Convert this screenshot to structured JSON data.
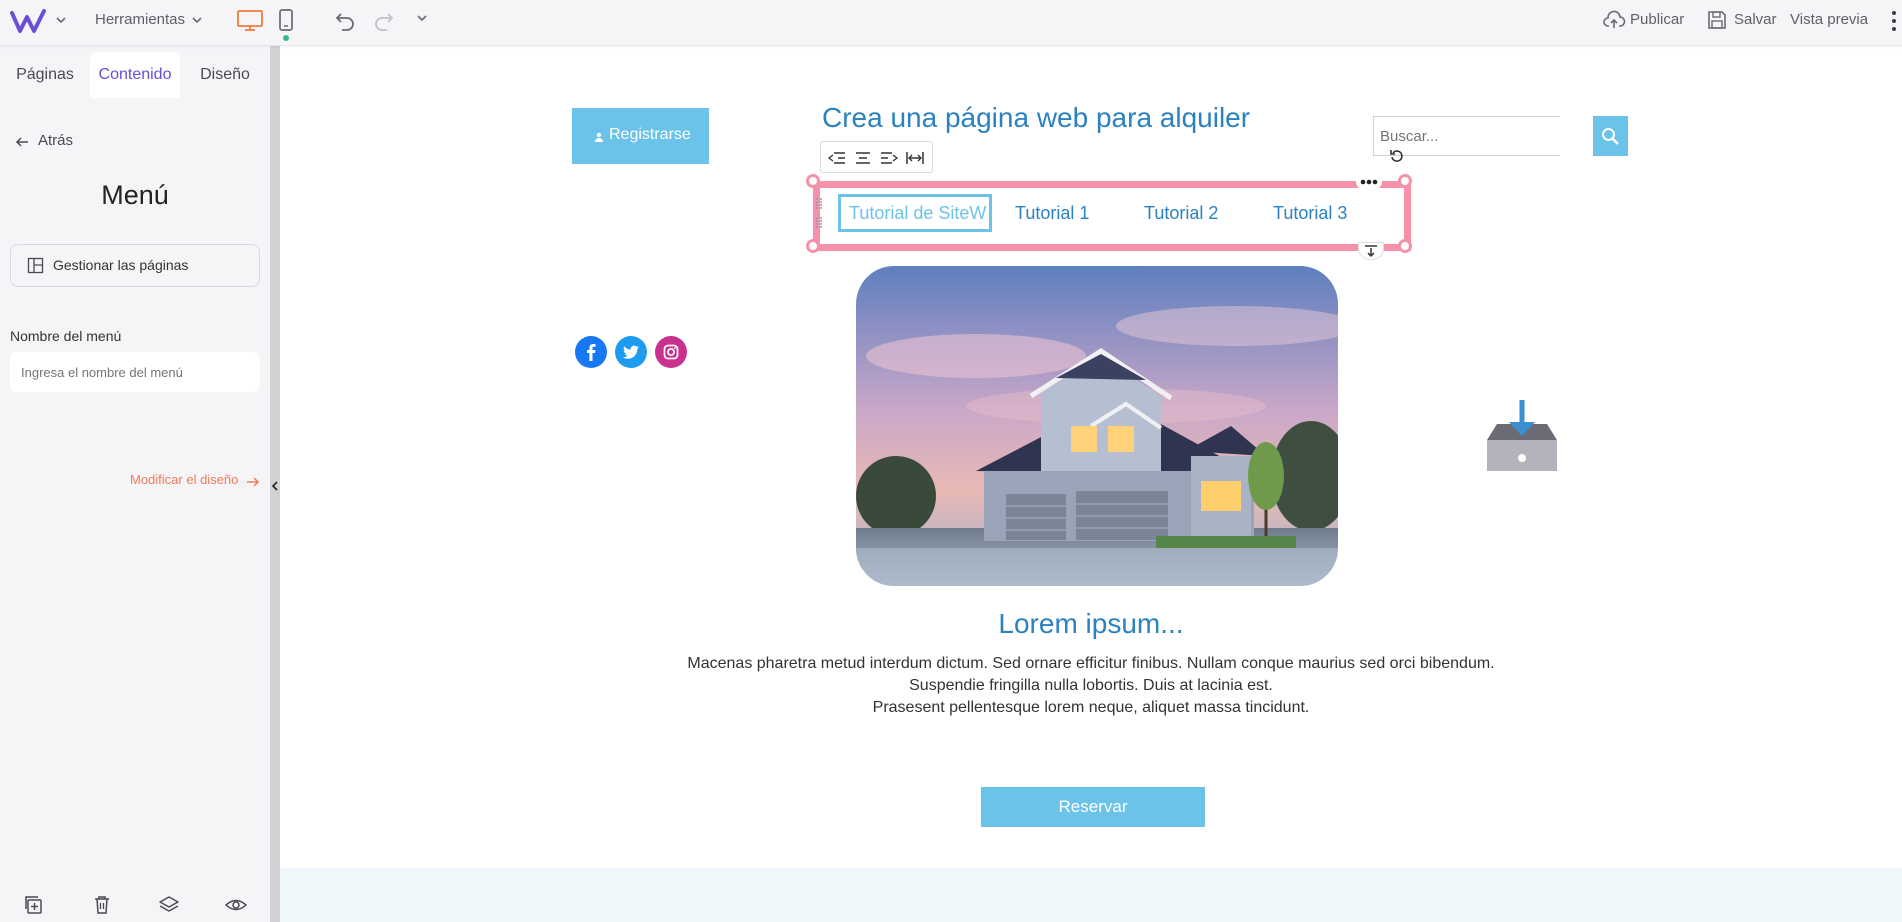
{
  "topbar": {
    "tools_label": "Herramientas",
    "publish_label": "Publicar",
    "save_label": "Salvar",
    "preview_label": "Vista previa"
  },
  "sidebar": {
    "tabs": [
      {
        "label": "Páginas"
      },
      {
        "label": "Contenido"
      },
      {
        "label": "Diseño"
      }
    ],
    "back_label": "Atrás",
    "title": "Menú",
    "manage_pages_label": "Gestionar las páginas",
    "menu_name_label": "Nombre del menú",
    "menu_name_placeholder": "Ingresa el nombre del menú",
    "modify_design_label": "Modificar el diseño"
  },
  "canvas": {
    "register_label": "Registrarse",
    "site_title": "Crea una página web para alquiler",
    "search_placeholder": "Buscar...",
    "nav_items": [
      {
        "label": "Tutorial de SiteW"
      },
      {
        "label": "Tutorial 1"
      },
      {
        "label": "Tutorial 2"
      },
      {
        "label": "Tutorial 3"
      }
    ],
    "heading": "Lorem ipsum...",
    "body_lines": [
      "Macenas pharetra metud interdum dictum. Sed ornare efficitur finibus. Nullam conque maurius sed orci bibendum.",
      "Suspendie fringilla nulla lobortis. Duis at lacinia est.",
      "Prasesent pellentesque lorem neque, aliquet massa tincidunt."
    ],
    "book_label": "Reservar"
  },
  "colors": {
    "accent_purple": "#6a4fd6",
    "accent_orange": "#f07a3a",
    "selection_pink": "#f591a8",
    "title_blue": "#2a82c0",
    "button_blue": "#6cc3ea"
  },
  "icons": {
    "logo": "sitew-logo",
    "device_desktop": "desktop-icon",
    "device_mobile": "mobile-icon",
    "undo": "undo-icon",
    "redo": "redo-icon",
    "publish": "cloud-upload-icon",
    "save": "floppy-disk-icon",
    "more": "vertical-dots-icon"
  }
}
